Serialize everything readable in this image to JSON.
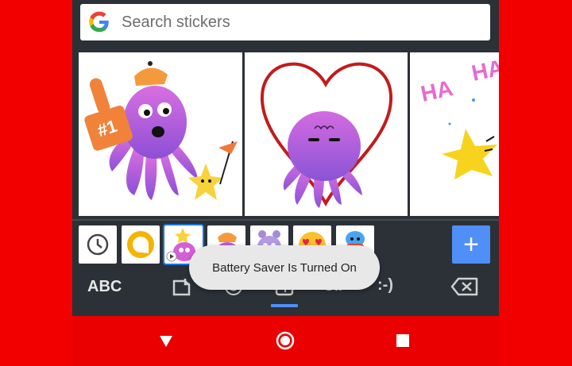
{
  "search": {
    "placeholder": "Search stickers"
  },
  "stickers": [
    {
      "name": "octopus-with-foam-finger",
      "foam_text": "#1"
    },
    {
      "name": "octopus-in-heart"
    },
    {
      "name": "laughing-star",
      "text1": "HA",
      "text2": "HA"
    }
  ],
  "recent_icons": [
    "clock-icon",
    "allo-icon",
    "octopus-star-icon",
    "octopus-hat-icon",
    "octopus-purple-icon",
    "heart-eyes-emoji-icon",
    "blue-character-icon"
  ],
  "toast": {
    "text": "Battery Saver Is Turned On"
  },
  "toolbar": {
    "abc_label": "ABC",
    "gif_label": "GIF",
    "emoticon_label": ":-)"
  },
  "colors": {
    "accent": "#4f8ff7",
    "background": "#2b3137",
    "frame": "#f20000"
  }
}
